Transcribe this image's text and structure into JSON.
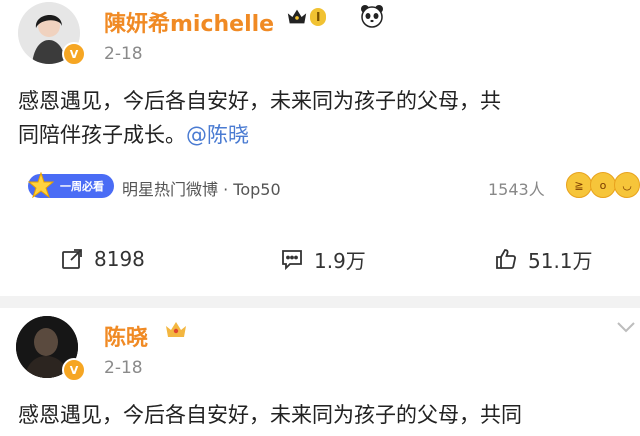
{
  "posts": [
    {
      "username": "陳妍希michelle",
      "level": "I",
      "date": "2-18",
      "content_line1": "感恩遇见，今后各自安好，未来同为孩子的父母，共",
      "content_line2_text": "同陪伴孩子成长。",
      "mention": "@陈晓",
      "hot_logo_text": "一周必看",
      "hot_text": "明星热门微博 · Top50",
      "reaction_count": "1543人",
      "share_count": "8198",
      "comment_count": "1.9万",
      "like_count": "51.1万"
    },
    {
      "username": "陈晓",
      "date": "2-18",
      "content_line1": "感恩遇见，今后各自安好，未来同为孩子的父母，共同"
    }
  ],
  "colors": {
    "username": "#f08a24",
    "mention": "#4a7bd2",
    "vip_badge": "#f6a623"
  },
  "icons": [
    "crown-icon",
    "panda-icon",
    "share-icon",
    "comment-icon",
    "like-icon",
    "chevron-down-icon"
  ]
}
